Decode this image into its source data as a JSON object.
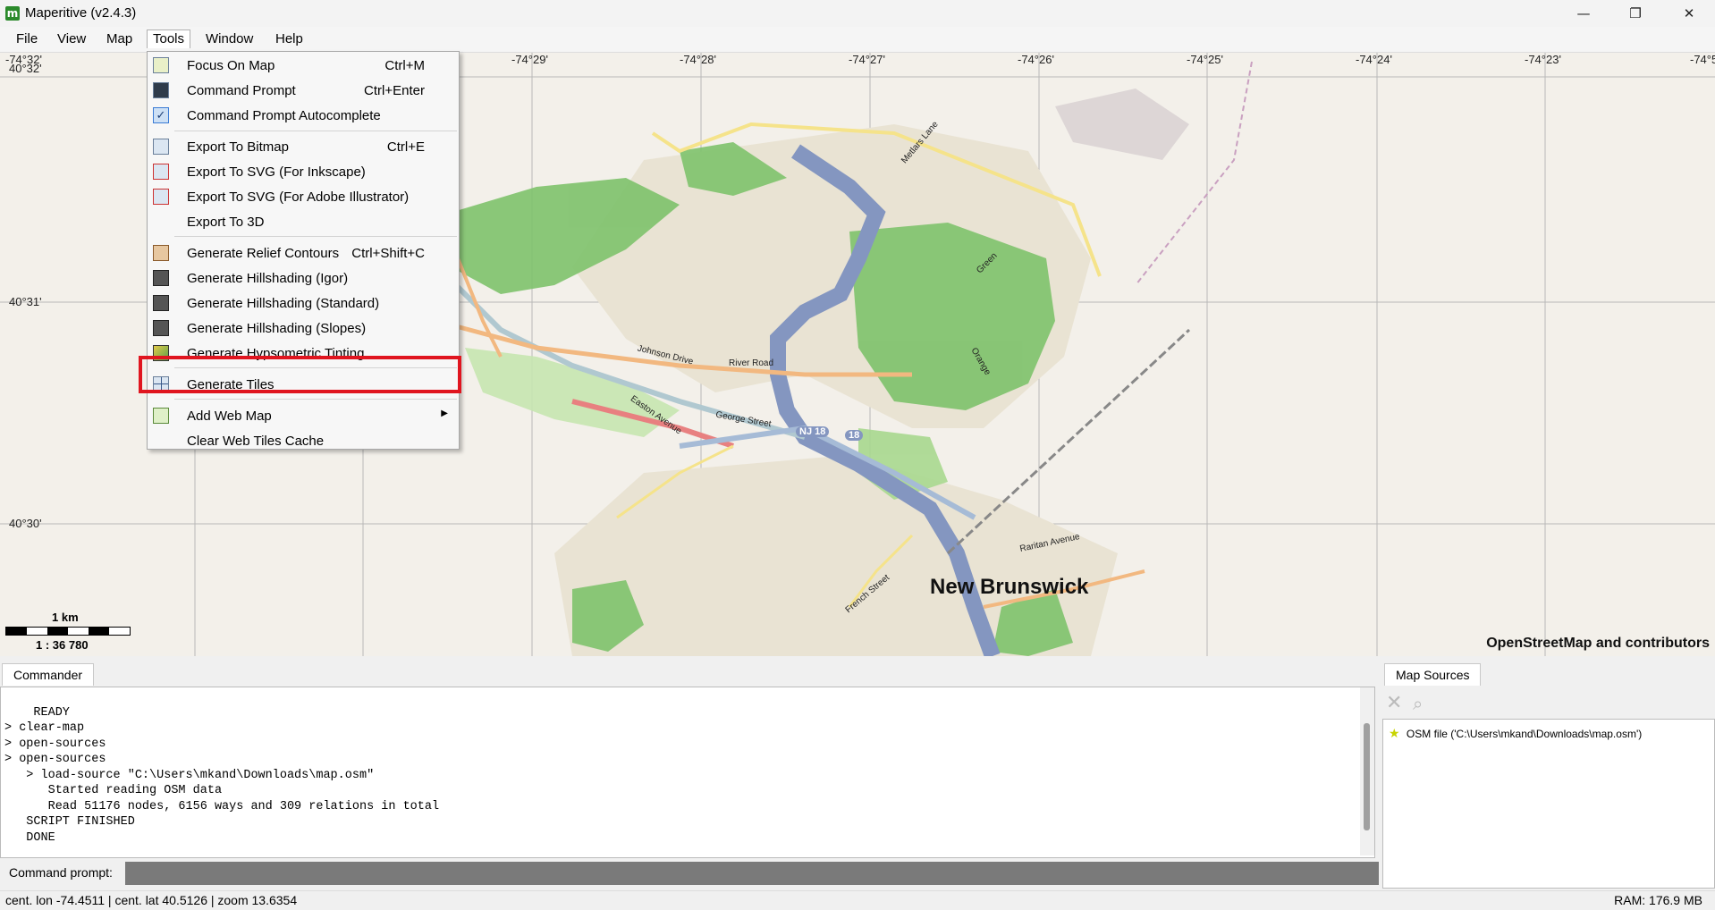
{
  "window": {
    "title": "Maperitive (v2.4.3)",
    "app_icon_letter": "m",
    "controls": {
      "minimize": "—",
      "maximize": "❐",
      "close": "✕"
    }
  },
  "menubar": {
    "file": "File",
    "view": "View",
    "map": "Map",
    "tools": "Tools",
    "window": "Window",
    "help": "Help"
  },
  "tools_menu": {
    "items": [
      {
        "label": "Focus On Map",
        "shortcut": "Ctrl+M",
        "icon": "map-focus-icon"
      },
      {
        "label": "Command Prompt",
        "shortcut": "Ctrl+Enter",
        "icon": "console-icon"
      },
      {
        "label": "Command Prompt Autocomplete",
        "shortcut": "",
        "icon": "checkmark-icon",
        "checked": true
      },
      {
        "label": "Export To Bitmap",
        "shortcut": "Ctrl+E",
        "icon": "bitmap-icon"
      },
      {
        "label": "Export To SVG (For Inkscape)",
        "shortcut": "",
        "icon": "svg-icon"
      },
      {
        "label": "Export To SVG (For Adobe Illustrator)",
        "shortcut": "",
        "icon": "svg-icon"
      },
      {
        "label": "Export To 3D",
        "shortcut": "",
        "icon": ""
      },
      {
        "label": "Generate Relief Contours",
        "shortcut": "Ctrl+Shift+C",
        "icon": "contours-icon"
      },
      {
        "label": "Generate Hillshading (Igor)",
        "shortcut": "",
        "icon": "hillshading-icon"
      },
      {
        "label": "Generate Hillshading (Standard)",
        "shortcut": "",
        "icon": "hillshading-icon"
      },
      {
        "label": "Generate Hillshading (Slopes)",
        "shortcut": "",
        "icon": "hillshading-icon"
      },
      {
        "label": "Generate Hypsometric Tinting",
        "shortcut": "",
        "icon": "hypsometric-icon"
      },
      {
        "label": "Generate Tiles",
        "shortcut": "",
        "icon": "tiles-icon"
      },
      {
        "label": "Add Web Map",
        "shortcut": "",
        "icon": "web-map-icon",
        "submenu": true
      },
      {
        "label": "Clear Web Tiles Cache",
        "shortcut": "",
        "icon": ""
      }
    ]
  },
  "map": {
    "lon_ticks": [
      "-74°32'",
      "-74°29'",
      "-74°28'",
      "-74°27'",
      "-74°26'",
      "-74°25'",
      "-74°24'",
      "-74°23'",
      "-74°5"
    ],
    "lat_ticks": [
      "40°32'",
      "40°31'",
      "40°30'"
    ],
    "city": "New Brunswick",
    "attribution": "OpenStreetMap and contributors",
    "scale_label": "1 km",
    "scale_ratio": "1 : 36 780",
    "road_labels": [
      "Johnson Drive",
      "River Road",
      "Easton Avenue",
      "George Street",
      "NJ 18",
      "18",
      "Raritan Avenue",
      "French Street",
      "Metlars Lane",
      "Orange",
      "Green"
    ]
  },
  "commander": {
    "tab": "Commander",
    "log": "READY\n> clear-map\n> open-sources\n> open-sources\n   > load-source \"C:\\Users\\mkand\\Downloads\\map.osm\"\n      Started reading OSM data\n      Read 51176 nodes, 6156 ways and 309 relations in total\n   SCRIPT FINISHED\n   DONE",
    "prompt_label": "Command prompt:"
  },
  "map_sources": {
    "tab": "Map Sources",
    "items": [
      {
        "label": "OSM file ('C:\\Users\\mkand\\Downloads\\map.osm')",
        "icon": "star-icon"
      }
    ]
  },
  "statusbar": {
    "position": "cent. lon -74.4511 | cent. lat 40.5126 | zoom 13.6354",
    "ram": "RAM: 176.9 MB"
  },
  "colors": {
    "highlight": "#e0151f",
    "park": "#7ec26b",
    "river": "#8496c0",
    "major_road": "#f5e38a",
    "primary_road": "#f2b880"
  }
}
